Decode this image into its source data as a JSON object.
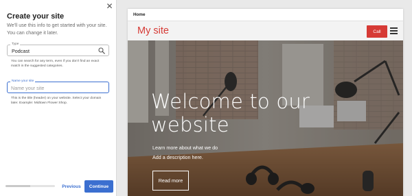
{
  "panel": {
    "close_glyph": "✕",
    "title": "Create your site",
    "intro": "We'll use this info to get started with your site. You can change it later.",
    "type_field": {
      "label": "Type",
      "value": "Podcast",
      "helper": "You can search for any term, even if you don't find an exact match in the suggested categories."
    },
    "name_field": {
      "label": "Name your site",
      "value": "",
      "placeholder": "Name your site",
      "helper": "This is the title (header) on your website. Select your domain later. Example: Midtown Flower Shop."
    },
    "progress_fraction": 0.5,
    "previous_label": "Previous",
    "continue_label": "Continue"
  },
  "preview": {
    "page_tab": "Home",
    "site_title": "My site",
    "call_label": "Call",
    "hero": {
      "heading": "Welcome to our website",
      "line1": "Learn more about what we do",
      "line2": "Add a description here.",
      "button_label": "Read more"
    }
  },
  "colors": {
    "accent_blue": "#3b6fd0",
    "brand_red": "#d63a35",
    "panel_bg": "#ffffff",
    "canvas_bg": "#e9e9e9"
  },
  "icons": {
    "close": "close-icon",
    "search": "search-icon",
    "menu": "hamburger-menu-icon"
  }
}
